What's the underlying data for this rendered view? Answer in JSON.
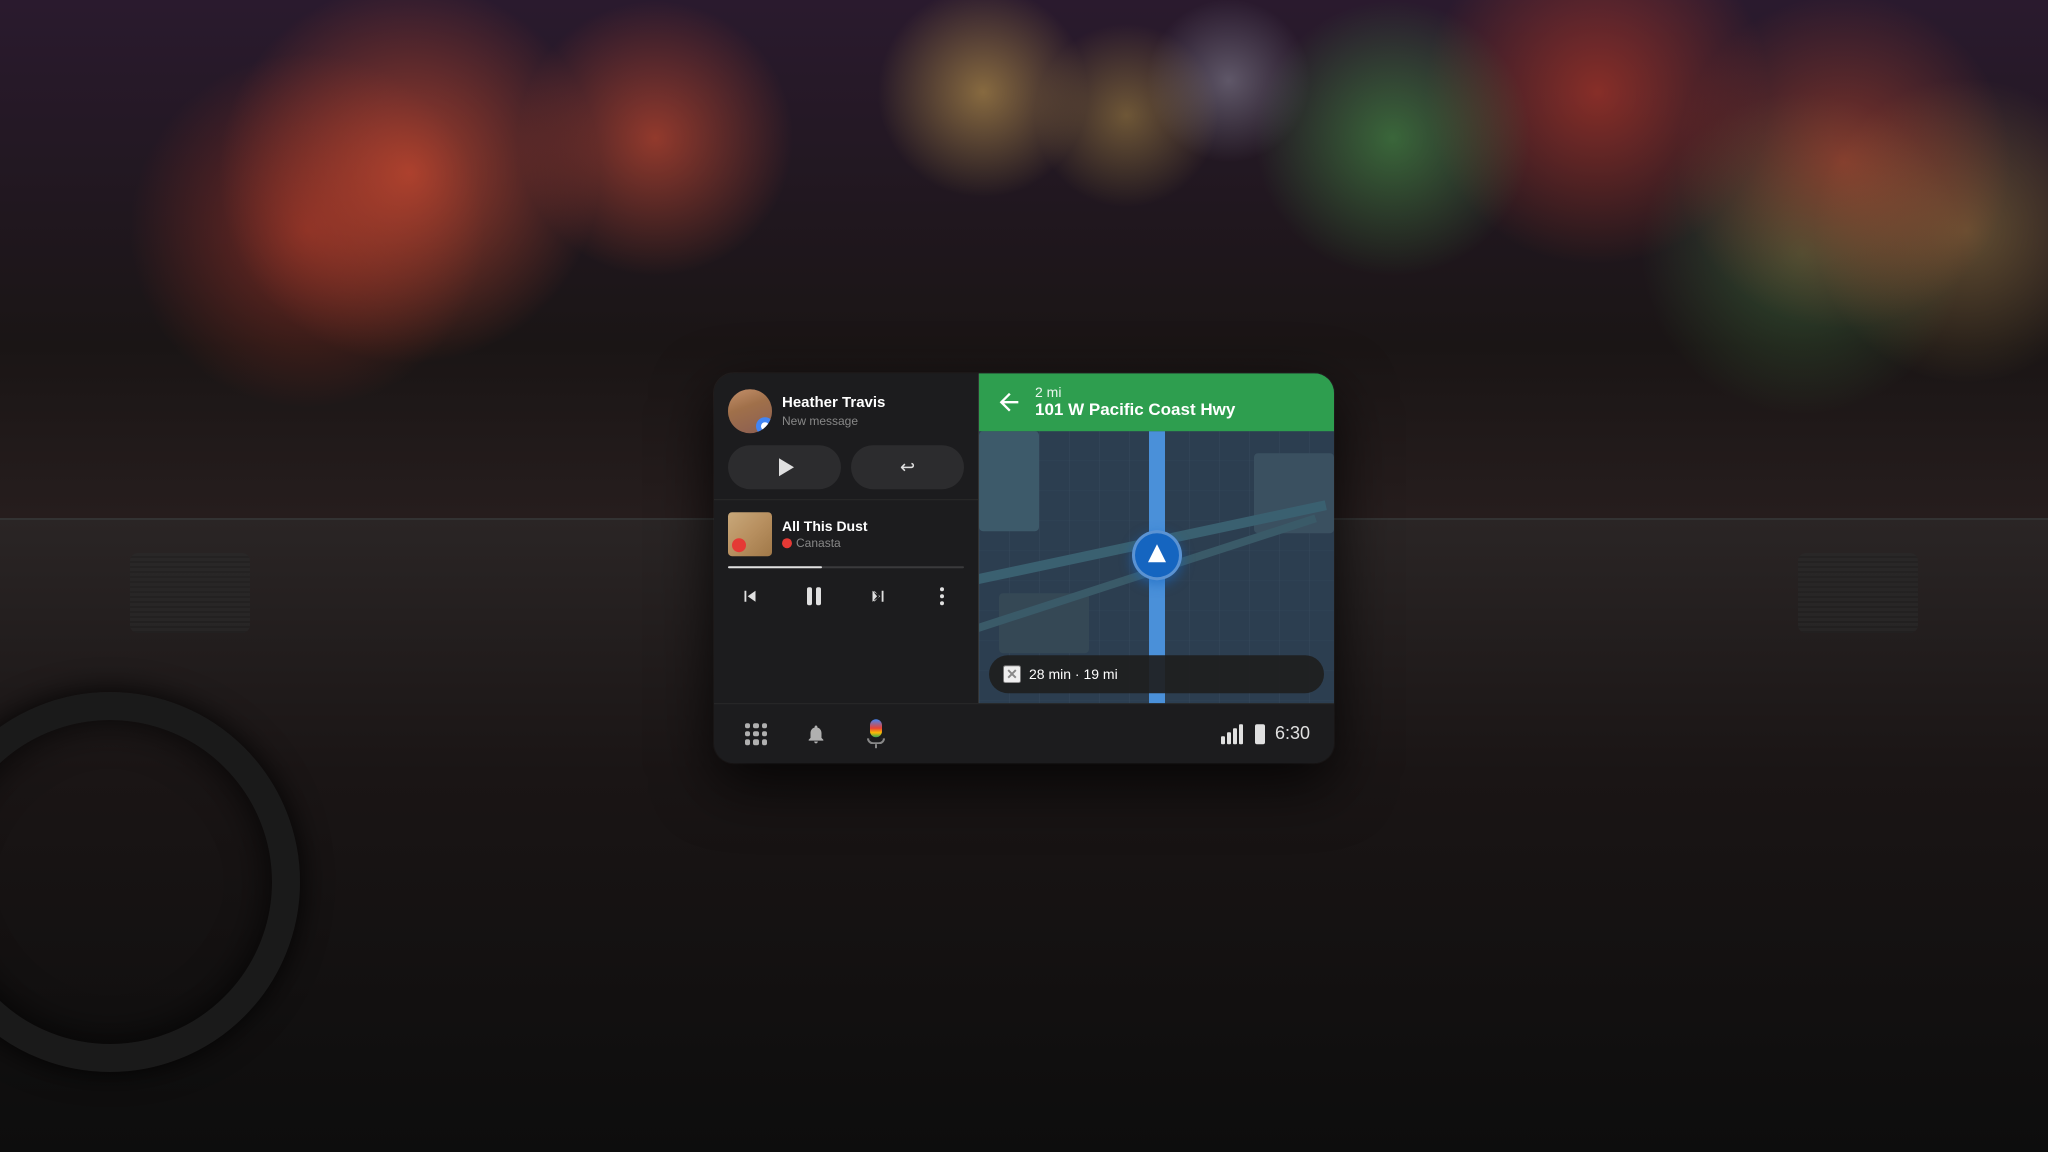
{
  "background": {
    "description": "Car interior dashboard with bokeh lights"
  },
  "display": {
    "message_card": {
      "sender_name": "Heather Travis",
      "message_label": "New message",
      "play_button_label": "Play",
      "reply_button_label": "Reply"
    },
    "music_card": {
      "track_name": "All This Dust",
      "artist_name": "Canasta",
      "has_record_icon": true
    },
    "music_controls": {
      "skip_prev_label": "Skip previous",
      "pause_label": "Pause",
      "skip_next_label": "Skip next",
      "more_label": "More options"
    },
    "navigation": {
      "distance": "2 mi",
      "road_name": "101 W Pacific Coast Hwy",
      "eta": "28 min · 19 mi",
      "turn_direction": "left"
    },
    "bottom_bar": {
      "apps_label": "Apps",
      "notifications_label": "Notifications",
      "assistant_label": "Google Assistant",
      "time": "6:30"
    }
  }
}
